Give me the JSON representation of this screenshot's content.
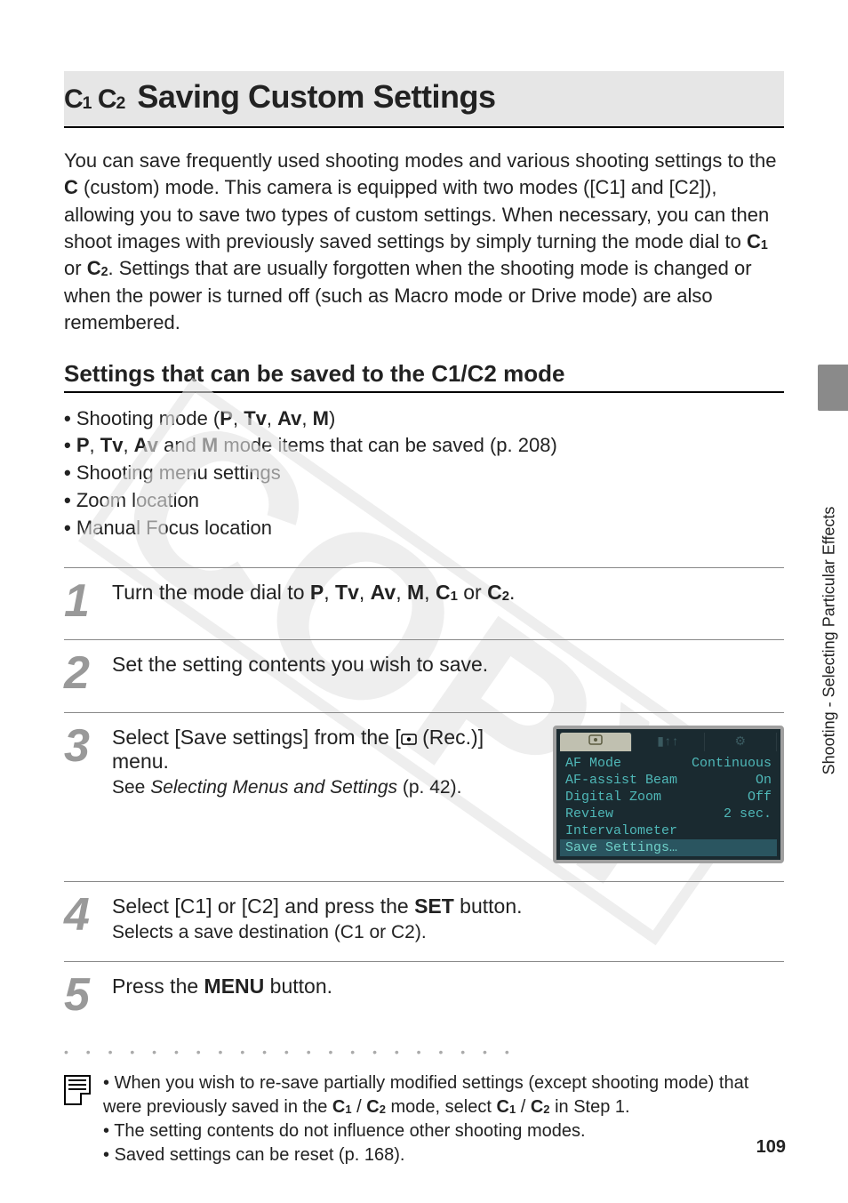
{
  "title": {
    "icon_prefix": "C1 C2",
    "text": "Saving Custom Settings"
  },
  "intro": "You can save frequently used shooting modes and various shooting settings to the C (custom) mode. This camera is equipped with two modes ([C1] and [C2]), allowing you to save two types of custom settings. When necessary, you can then shoot images with previously saved settings by simply turning the mode dial to C1 or C2. Settings that are usually forgotten when the shooting mode is changed or when the power is turned off (such as Macro mode or Drive mode) are also remembered.",
  "sub_heading": "Settings that can be saved to the C1/C2 mode",
  "bullets": [
    "Shooting mode (P, Tv, Av, M)",
    "P, Tv, Av and M mode items that can be saved (p. 208)",
    "Shooting menu settings",
    "Zoom location",
    "Manual Focus location"
  ],
  "watermark": "COPY",
  "steps": [
    {
      "num": "1",
      "title": "Turn the mode dial to P, Tv, Av, M, C1 or C2."
    },
    {
      "num": "2",
      "title": "Set the setting contents you wish to save."
    },
    {
      "num": "3",
      "title": "Select [Save settings] from the [● (Rec.)] menu.",
      "sub_pre": "See ",
      "sub_ital": "Selecting Menus and Settings",
      "sub_post": " (p. 42).",
      "lcd": {
        "tabs": [
          "●",
          "▮↑↑",
          "⚙"
        ],
        "rows": [
          {
            "label": "AF Mode",
            "value": "Continuous"
          },
          {
            "label": "AF-assist Beam",
            "value": "On"
          },
          {
            "label": "Digital Zoom",
            "value": "Off"
          },
          {
            "label": "Review",
            "value": "2 sec."
          },
          {
            "label": "Intervalometer",
            "value": ""
          },
          {
            "label": "Save Settings…",
            "value": "",
            "selected": true
          }
        ]
      }
    },
    {
      "num": "4",
      "title": "Select [C1] or [C2] and press the SET button.",
      "sub": "Selects a save destination (C1 or C2)."
    },
    {
      "num": "5",
      "title": "Press the MENU button."
    }
  ],
  "dots": "• • • • • • • • • • • • • • • • • • • • •",
  "notes": [
    "When you wish to re-save partially modified settings (except shooting mode) that were previously saved in the C1 / C2 mode, select C1 / C2 in Step 1.",
    "The setting contents do not influence other shooting modes.",
    "Saved settings can be reset (p. 168)."
  ],
  "side_tab": "Shooting - Selecting Particular Effects",
  "page_number": "109"
}
